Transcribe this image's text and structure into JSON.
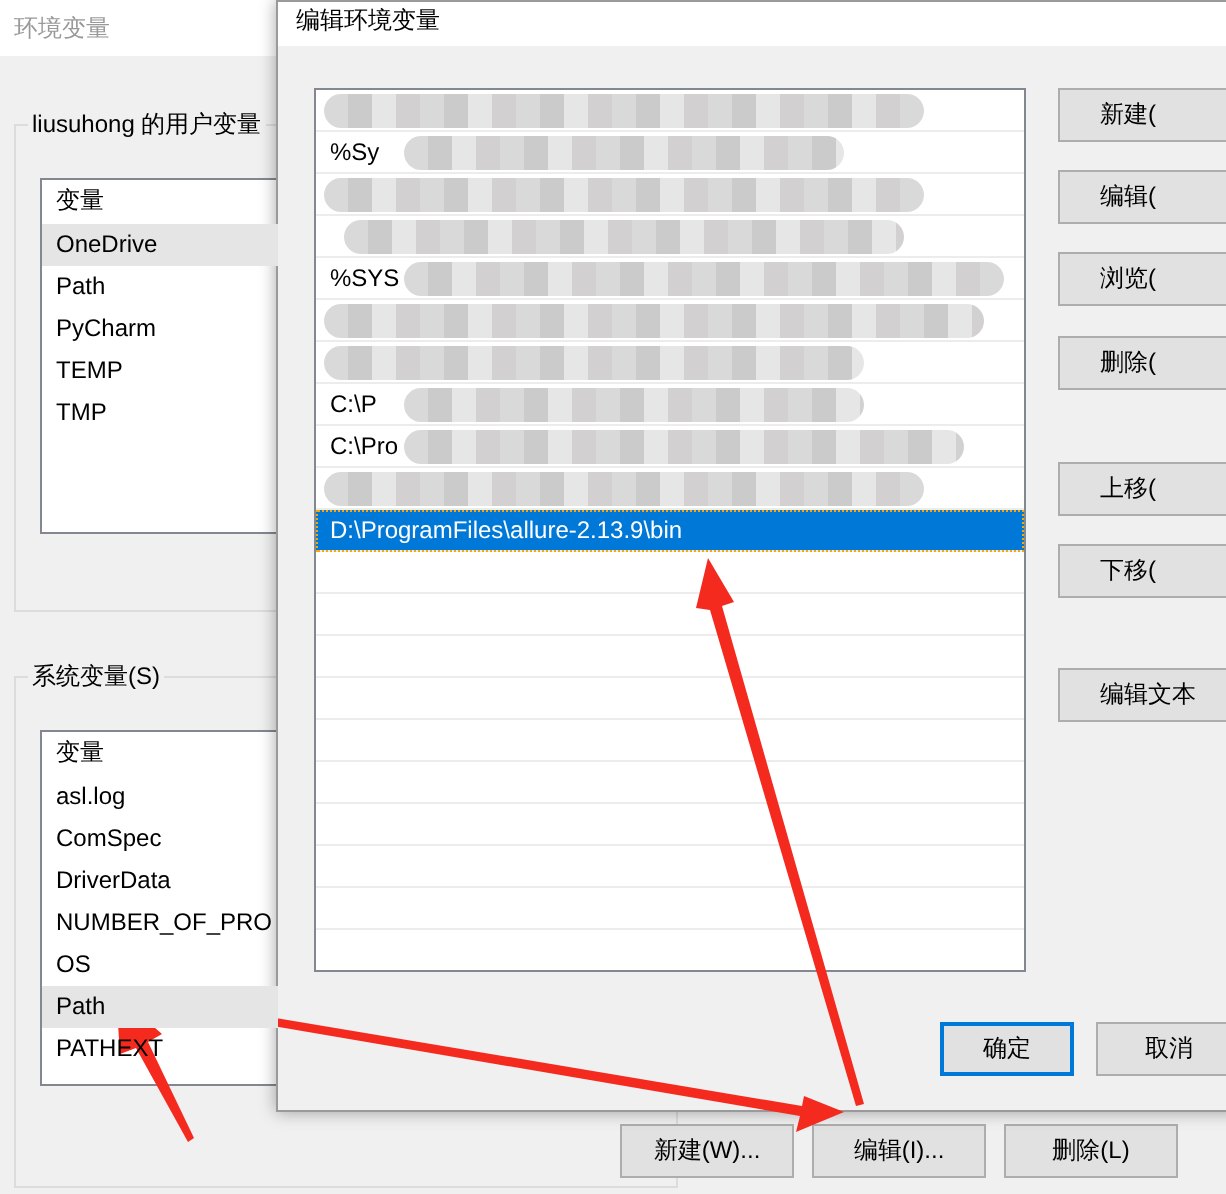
{
  "back_window": {
    "title": "环境变量",
    "user_group": {
      "label": "liusuhong 的用户变量",
      "header": "变量",
      "rows": [
        {
          "name": "OneDrive",
          "selected": true
        },
        {
          "name": "Path",
          "selected": false
        },
        {
          "name": "PyCharm",
          "selected": false
        },
        {
          "name": "TEMP",
          "selected": false
        },
        {
          "name": "TMP",
          "selected": false
        }
      ]
    },
    "system_group": {
      "label": "系统变量(S)",
      "header": "变量",
      "rows": [
        {
          "name": "asl.log",
          "selected": false
        },
        {
          "name": "ComSpec",
          "selected": false
        },
        {
          "name": "DriverData",
          "selected": false
        },
        {
          "name": "NUMBER_OF_PRO",
          "selected": false
        },
        {
          "name": "OS",
          "selected": false
        },
        {
          "name": "Path",
          "selected": true
        },
        {
          "name": "PATHEXT",
          "selected": false
        }
      ],
      "buttons": [
        "新建(W)...",
        "编辑(I)...",
        "删除(L)"
      ]
    }
  },
  "dialog": {
    "title": "编辑环境变量",
    "paths": [
      {
        "selected": false
      },
      {
        "text": "%Sy",
        "selected": false
      },
      {
        "selected": false
      },
      {
        "selected": false
      },
      {
        "text": "%SYS",
        "selected": false
      },
      {
        "selected": false
      },
      {
        "selected": false
      },
      {
        "text": "C:\\P",
        "selected": false
      },
      {
        "text": "C:\\Pro",
        "selected": false
      },
      {
        "selected": false
      },
      {
        "text": "D:\\ProgramFiles\\allure-2.13.9\\bin",
        "selected": true
      }
    ],
    "side_buttons": [
      "新建(",
      "编辑(",
      "浏览(",
      "删除(",
      "上移(",
      "下移(",
      "编辑文本"
    ],
    "ok": "确定",
    "cancel": "取消"
  }
}
